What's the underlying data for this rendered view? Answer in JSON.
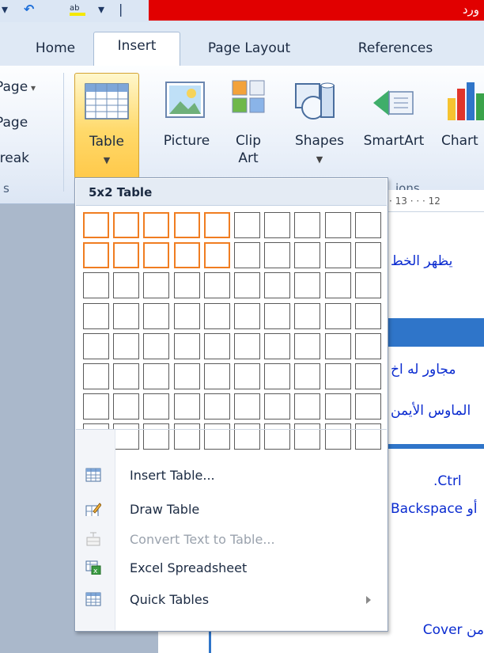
{
  "title_bar": {
    "title_fragment": "ورد"
  },
  "tabs": [
    {
      "label": "Home"
    },
    {
      "label": "Insert"
    },
    {
      "label": "Page Layout"
    },
    {
      "label": "References"
    }
  ],
  "active_tab": "Insert",
  "ribbon": {
    "left_partial": [
      "Page",
      "Page",
      "Break"
    ],
    "buttons": {
      "table": {
        "label": "Table"
      },
      "picture": {
        "label": "Picture"
      },
      "clipart": {
        "label_line1": "Clip",
        "label_line2": "Art"
      },
      "shapes": {
        "label": "Shapes"
      },
      "smartart": {
        "label": "SmartArt"
      },
      "chart": {
        "label": "Chart"
      }
    },
    "group_label_partial": "ions"
  },
  "ruler": {
    "text": "· 13 · · · 12"
  },
  "document": {
    "lines": [
      "يظهر الخط",
      "مجاور له اخ",
      "الماوس الأيمن",
      ".Ctrl",
      "أو Backspace",
      "من Cover"
    ]
  },
  "table_menu": {
    "header": "5x2 Table",
    "grid": {
      "columns": 10,
      "rows": 8,
      "highlight_columns": 5,
      "highlight_rows": 2
    },
    "items": [
      {
        "label": "Insert Table...",
        "icon": "insert-table-icon",
        "enabled": true,
        "submenu": false
      },
      {
        "label": "Draw Table",
        "icon": "draw-table-icon",
        "enabled": true,
        "submenu": false
      },
      {
        "label": "Convert Text to Table...",
        "icon": "convert-text-icon",
        "enabled": false,
        "submenu": false
      },
      {
        "label": "Excel Spreadsheet",
        "icon": "excel-spreadsheet-icon",
        "enabled": true,
        "submenu": false
      },
      {
        "label": "Quick Tables",
        "icon": "quick-tables-icon",
        "enabled": true,
        "submenu": true
      }
    ]
  },
  "colors": {
    "highlight": "#f07d21",
    "accent_blue": "#2f75c9",
    "title_red": "#e10000"
  }
}
